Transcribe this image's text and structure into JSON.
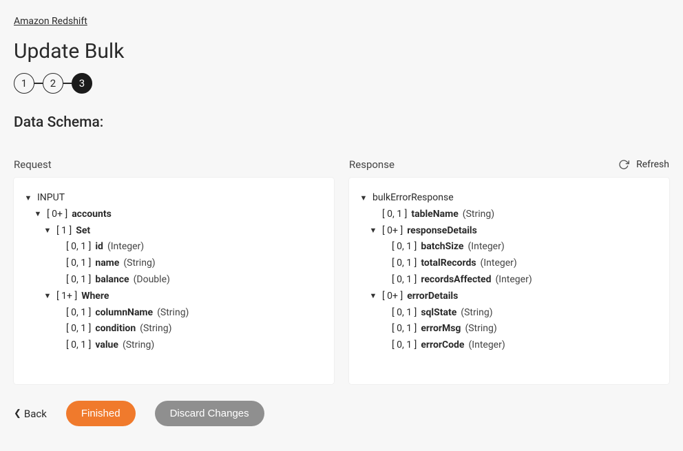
{
  "breadcrumb": "Amazon Redshift",
  "page_title": "Update Bulk",
  "stepper": {
    "steps": [
      "1",
      "2",
      "3"
    ],
    "active_index": 2
  },
  "section_title": "Data Schema:",
  "columns": {
    "request_label": "Request",
    "response_label": "Response",
    "refresh_label": "Refresh"
  },
  "request_tree": {
    "root": "INPUT",
    "accounts": {
      "card": "[ 0+ ]",
      "name": "accounts"
    },
    "set": {
      "card": "[ 1 ]",
      "name": "Set"
    },
    "set_fields": [
      {
        "card": "[ 0, 1 ]",
        "name": "id",
        "type": "(Integer)"
      },
      {
        "card": "[ 0, 1 ]",
        "name": "name",
        "type": "(String)"
      },
      {
        "card": "[ 0, 1 ]",
        "name": "balance",
        "type": "(Double)"
      }
    ],
    "where": {
      "card": "[ 1+ ]",
      "name": "Where"
    },
    "where_fields": [
      {
        "card": "[ 0, 1 ]",
        "name": "columnName",
        "type": "(String)"
      },
      {
        "card": "[ 0, 1 ]",
        "name": "condition",
        "type": "(String)"
      },
      {
        "card": "[ 0, 1 ]",
        "name": "value",
        "type": "(String)"
      }
    ]
  },
  "response_tree": {
    "root": "bulkErrorResponse",
    "tableName": {
      "card": "[ 0, 1 ]",
      "name": "tableName",
      "type": "(String)"
    },
    "responseDetails": {
      "card": "[ 0+ ]",
      "name": "responseDetails"
    },
    "responseDetails_fields": [
      {
        "card": "[ 0, 1 ]",
        "name": "batchSize",
        "type": "(Integer)"
      },
      {
        "card": "[ 0, 1 ]",
        "name": "totalRecords",
        "type": "(Integer)"
      },
      {
        "card": "[ 0, 1 ]",
        "name": "recordsAffected",
        "type": "(Integer)"
      }
    ],
    "errorDetails": {
      "card": "[ 0+ ]",
      "name": "errorDetails"
    },
    "errorDetails_fields": [
      {
        "card": "[ 0, 1 ]",
        "name": "sqlState",
        "type": "(String)"
      },
      {
        "card": "[ 0, 1 ]",
        "name": "errorMsg",
        "type": "(String)"
      },
      {
        "card": "[ 0, 1 ]",
        "name": "errorCode",
        "type": "(Integer)"
      }
    ]
  },
  "buttons": {
    "back": "Back",
    "finished": "Finished",
    "discard": "Discard Changes"
  }
}
